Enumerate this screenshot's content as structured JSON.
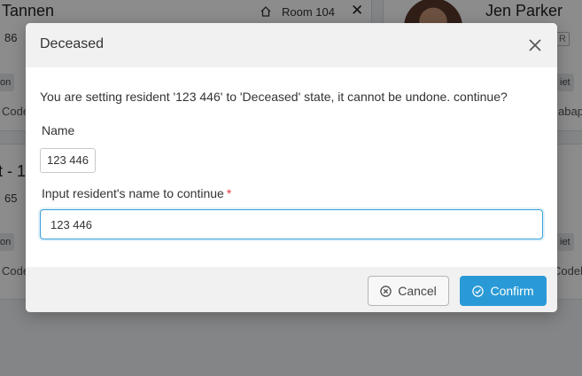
{
  "background": {
    "card_a": {
      "name": "Tannen",
      "room_label": "Room 104",
      "number": "86",
      "chips": [
        "on",
        "Code"
      ]
    },
    "card_b": {
      "name": "Jen Parker",
      "tag": "R",
      "chips": [
        "iet",
        "abapo"
      ]
    },
    "card_c": {
      "title": "t - 1",
      "number": "65",
      "chips": [
        "on",
        "Code"
      ]
    },
    "card_d": {
      "chips": [
        "iet",
        "Codel"
      ]
    }
  },
  "modal": {
    "title": "Deceased",
    "message": "You are setting resident '123 446' to 'Deceased' state, it cannot be undone. continue?",
    "name_label": "Name",
    "name_value": "123 446",
    "input_label": "Input resident's name to continue",
    "required_mark": "*",
    "input_value": "123 446",
    "cancel_label": "Cancel",
    "confirm_label": "Confirm"
  },
  "colors": {
    "accent": "#2a9ad6",
    "required": "#e4393c"
  },
  "icons": {
    "close": "close-icon",
    "cancel": "circle-x-icon",
    "confirm": "circle-check-icon",
    "home": "home-icon"
  }
}
